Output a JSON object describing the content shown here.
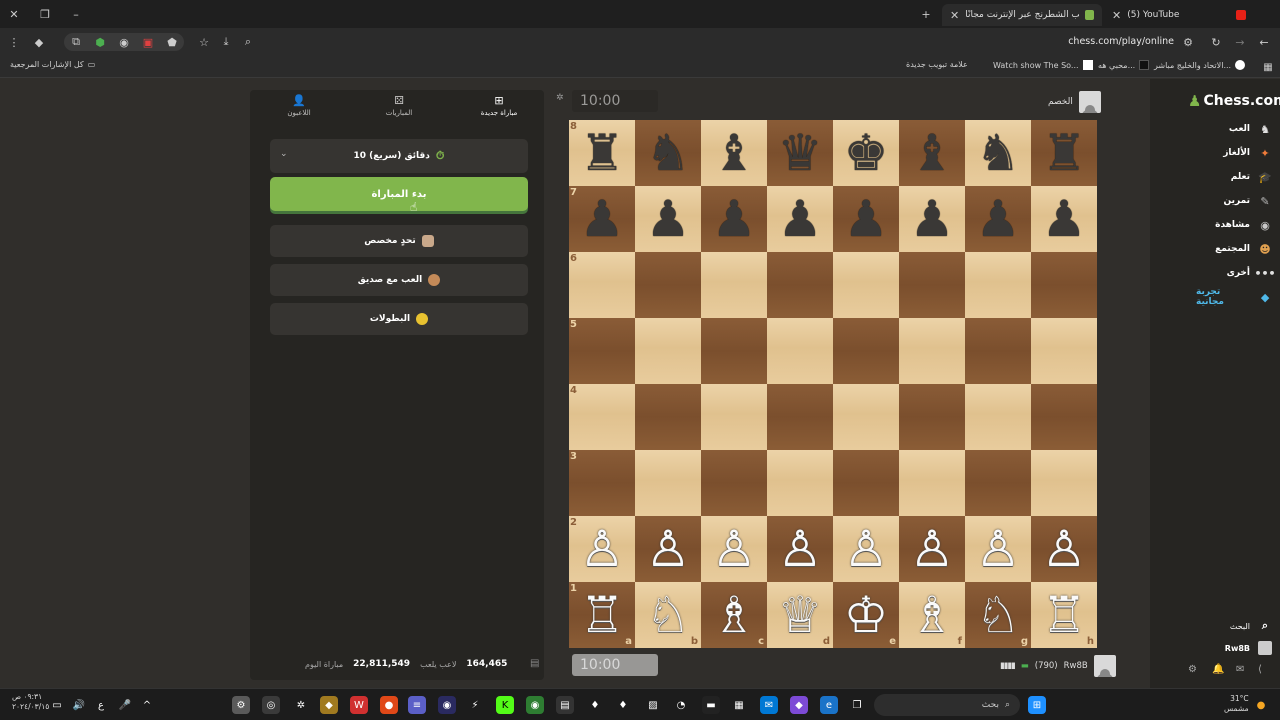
{
  "browser": {
    "tabs": [
      {
        "title": "(5) YouTube",
        "active": false,
        "icon": "youtube-icon"
      },
      {
        "title": "العب الشطرنج عبر الإنترنت مجانًا",
        "active": true,
        "icon": "chess-pawn-icon"
      }
    ],
    "url": "chess.com/play/online",
    "bookmarks": [
      {
        "label": "الاتحاد والخليج مباشر...",
        "icon": "google-icon"
      },
      {
        "label": "محبي هه...",
        "icon": "tiktok-icon"
      },
      {
        "label": "Watch show The So...",
        "icon": "page-icon"
      },
      {
        "label": "علامة تبويب جديدة",
        "icon": "none"
      },
      {
        "label": "كل الإشارات المرجعية",
        "icon": "folder-icon"
      }
    ]
  },
  "panel": {
    "tabs": [
      {
        "label": "مباراة جديدة",
        "icon": "plus-square-icon",
        "active": true
      },
      {
        "label": "المباريات",
        "icon": "games-icon",
        "active": false
      },
      {
        "label": "اللاعبون",
        "icon": "players-icon",
        "active": false
      }
    ],
    "time_control": "10 دقائق (سريع)",
    "start_button": "بدء المباراة",
    "options": [
      {
        "label": "تحدٍ مخصص",
        "icon": "custom-challenge-icon"
      },
      {
        "label": "العب مع صديق",
        "icon": "handshake-icon"
      },
      {
        "label": "البطولات",
        "icon": "trophy-icon"
      }
    ],
    "stats": {
      "games_today_value": "22,811,549",
      "games_today_label": "مباراة اليوم",
      "players_value": "164,465",
      "players_label": "لاعب يلعب"
    }
  },
  "game": {
    "clock_top": "10:00",
    "clock_bottom": "10:00",
    "opponent_label": "الخصم",
    "me_name": "Rw8B",
    "me_rating": "(790)",
    "board": {
      "ranks": [
        "8",
        "7",
        "6",
        "5",
        "4",
        "3",
        "2",
        "1"
      ],
      "files": [
        "a",
        "b",
        "c",
        "d",
        "e",
        "f",
        "g",
        "h"
      ],
      "pieces": {
        "8": [
          "♜",
          "♞",
          "♝",
          "♛",
          "♚",
          "♝",
          "♞",
          "♜"
        ],
        "7": [
          "♟",
          "♟",
          "♟",
          "♟",
          "♟",
          "♟",
          "♟",
          "♟"
        ],
        "2": [
          "♙",
          "♙",
          "♙",
          "♙",
          "♙",
          "♙",
          "♙",
          "♙"
        ],
        "1": [
          "♖",
          "♘",
          "♗",
          "♕",
          "♔",
          "♗",
          "♘",
          "♖"
        ]
      }
    }
  },
  "nav": {
    "logo": "Chess.com",
    "items": [
      {
        "label": "العب",
        "icon": "play-icon",
        "color": "#e0e0e0"
      },
      {
        "label": "الألغاز",
        "icon": "puzzle-icon",
        "color": "#f07c3a"
      },
      {
        "label": "تعلم",
        "icon": "learn-icon",
        "color": "#4fa3e0"
      },
      {
        "label": "تمرين",
        "icon": "practice-icon",
        "color": "#b9b9b9"
      },
      {
        "label": "مشاهدة",
        "icon": "watch-icon",
        "color": "#c8c8c8"
      },
      {
        "label": "المجتمع",
        "icon": "community-icon",
        "color": "#e0a050"
      },
      {
        "label": "أخرى",
        "icon": "more-icon",
        "color": "#e0e0e0"
      },
      {
        "label": "تجربة مجانية",
        "icon": "diamond-icon",
        "color": "#4fb8e8"
      }
    ],
    "search_label": "البحث",
    "user_label": "Rw8B"
  },
  "taskbar": {
    "search_label": "بحث",
    "time": "٠٩:٣١ ص",
    "date": "٢٠٢٤/٠٣/١٥",
    "weather_temp": "31°C",
    "weather_desc": "مشمس"
  },
  "colors": {
    "start_green": "#81b64c",
    "board_light": "#e6c99a",
    "board_dark": "#7f5331"
  }
}
